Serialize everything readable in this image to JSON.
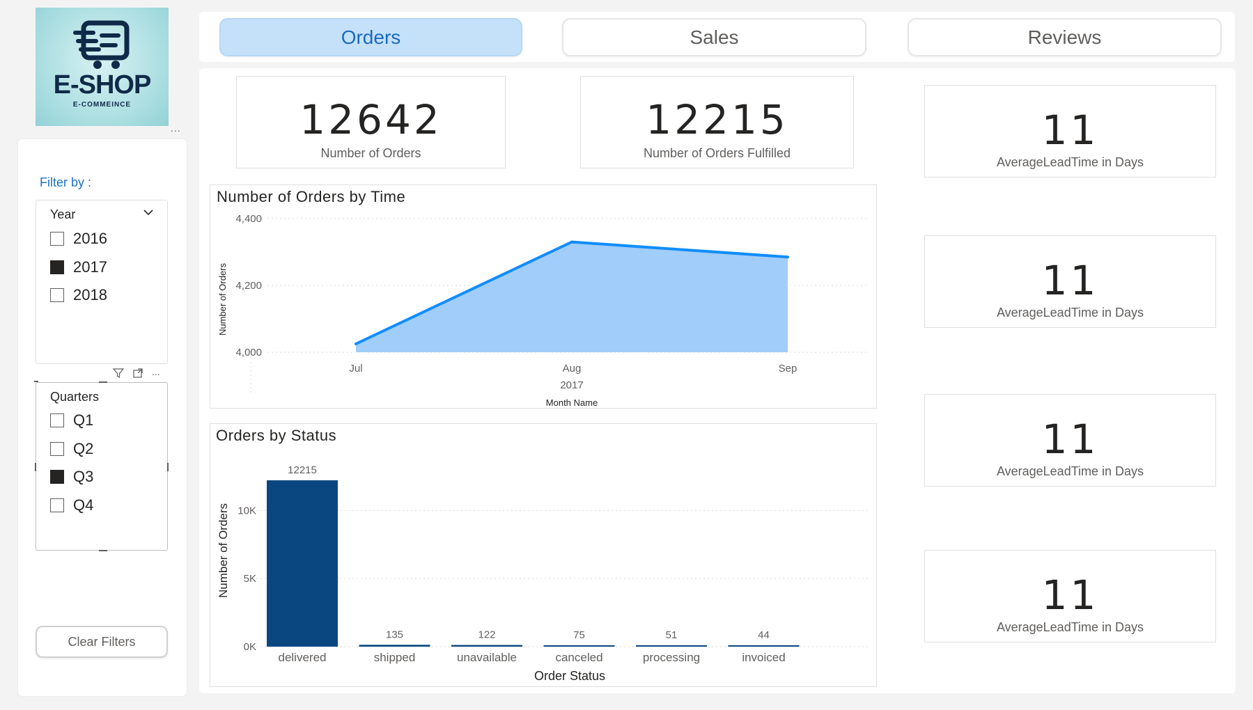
{
  "logo": {
    "title": "E-SHOP",
    "subtitle": "E-COMMEINCE"
  },
  "more_dots": "...",
  "filter": {
    "label": "Filter by :",
    "year": {
      "header": "Year",
      "options": [
        {
          "label": "2016",
          "checked": false
        },
        {
          "label": "2017",
          "checked": true
        },
        {
          "label": "2018",
          "checked": false
        }
      ]
    },
    "quarters": {
      "header": "Quarters",
      "options": [
        {
          "label": "Q1",
          "checked": false
        },
        {
          "label": "Q2",
          "checked": false
        },
        {
          "label": "Q3",
          "checked": true
        },
        {
          "label": "Q4",
          "checked": false
        }
      ]
    },
    "clear_label": "Clear Filters"
  },
  "nav": {
    "tabs": [
      {
        "label": "Orders",
        "active": true
      },
      {
        "label": "Sales",
        "active": false
      },
      {
        "label": "Reviews",
        "active": false
      }
    ]
  },
  "kpis": {
    "orders": {
      "value": "12642",
      "label": "Number of Orders"
    },
    "fulfilled": {
      "value": "12215",
      "label": "Number of Orders Fulfilled"
    }
  },
  "lead_time_cards": [
    {
      "value": "11",
      "label": "AverageLeadTime in Days"
    },
    {
      "value": "11",
      "label": "AverageLeadTime in Days"
    },
    {
      "value": "11",
      "label": "AverageLeadTime in Days"
    },
    {
      "value": "11",
      "label": "AverageLeadTime in Days"
    }
  ],
  "colors": {
    "accent": "#1b72c6",
    "area_fill": "#a0cdfa",
    "area_line": "#118dff",
    "bar": "#0a4780",
    "nav_active_bg": "#c5e1fa"
  },
  "chart_data": [
    {
      "type": "area",
      "title": "Number of Orders by Time",
      "xlabel": "Month Name",
      "ylabel": "Number of Orders",
      "x": [
        "Jul",
        "Aug",
        "Sep"
      ],
      "x_sublabel": "2017",
      "values": [
        4025,
        4330,
        4285
      ],
      "ylim": [
        4000,
        4400
      ],
      "yticks": [
        "4,000",
        "4,200",
        "4,400"
      ],
      "grid": true
    },
    {
      "type": "bar",
      "title": "Orders by Status",
      "xlabel": "Order Status",
      "ylabel": "Number of Orders",
      "categories": [
        "delivered",
        "shipped",
        "unavailable",
        "canceled",
        "processing",
        "invoiced"
      ],
      "values": [
        12215,
        135,
        122,
        75,
        51,
        44
      ],
      "data_labels": [
        "12215",
        "135",
        "122",
        "75",
        "51",
        "44"
      ],
      "ylim": [
        0,
        12215
      ],
      "yticks": [
        "0K",
        "5K",
        "10K"
      ],
      "grid": true
    }
  ]
}
